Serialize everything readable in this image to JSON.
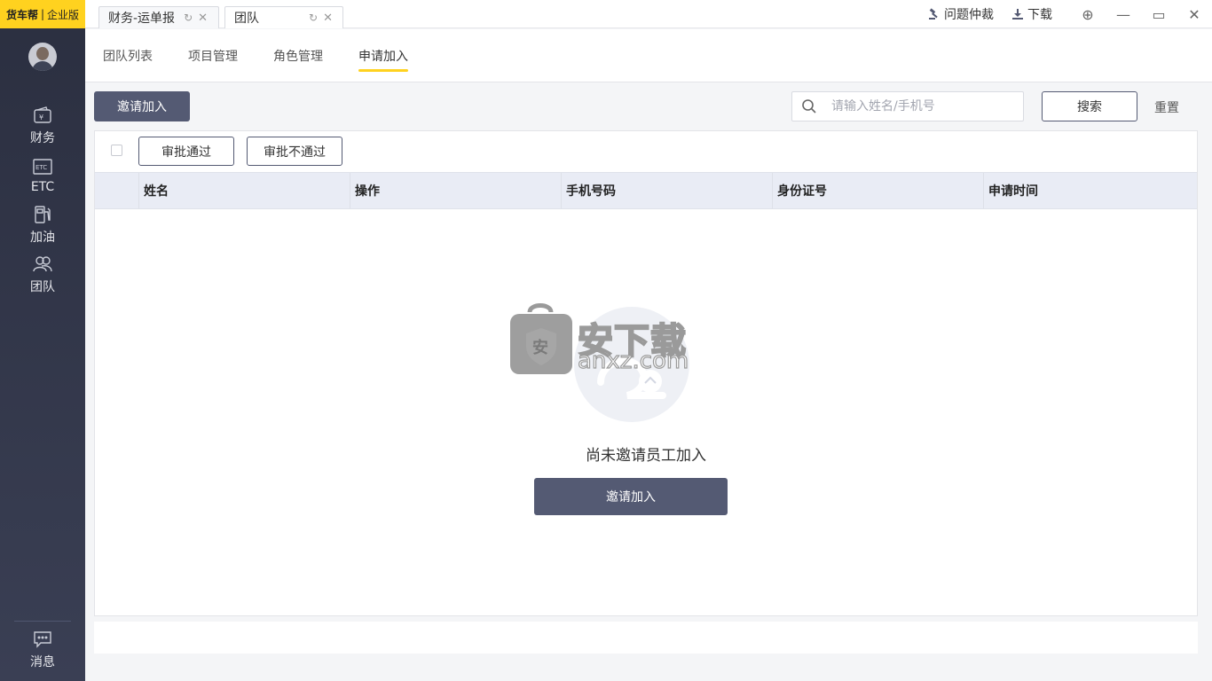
{
  "brand": {
    "logo": "货车帮",
    "separator": "|",
    "edition": "企业版"
  },
  "sidebar": {
    "items": [
      {
        "label": "财务",
        "icon": "wallet-icon"
      },
      {
        "label": "ETC",
        "icon": "etc-card-icon"
      },
      {
        "label": "加油",
        "icon": "fuel-pump-icon"
      },
      {
        "label": "团队",
        "icon": "team-icon"
      }
    ],
    "message": {
      "label": "消息",
      "icon": "chat-bubble-icon"
    }
  },
  "titlebar": {
    "tabs": [
      {
        "label": "财务-运单报"
      },
      {
        "label": "团队"
      }
    ],
    "links": {
      "dispute": "问题仲裁",
      "download": "下载"
    }
  },
  "subnav": {
    "tabs": [
      "团队列表",
      "项目管理",
      "角色管理",
      "申请加入"
    ],
    "active": "申请加入"
  },
  "toolbar": {
    "invite_label": "邀请加入",
    "search_placeholder": "请输入姓名/手机号",
    "search_value": "",
    "search_button": "搜索",
    "reset_button": "重置"
  },
  "panel": {
    "approve_label": "审批通过",
    "reject_label": "审批不通过",
    "columns": [
      "姓名",
      "操作",
      "手机号码",
      "身份证号",
      "申请时间"
    ],
    "rows": [],
    "empty_text": "尚未邀请员工加入",
    "empty_button": "邀请加入"
  },
  "watermark": {
    "main": "安下载",
    "sub": "anxz.com",
    "badge": "安"
  },
  "colors": {
    "brand_yellow": "#ffd21f",
    "sidebar_dark": "#2b2f40",
    "button_dark": "#545a73"
  }
}
